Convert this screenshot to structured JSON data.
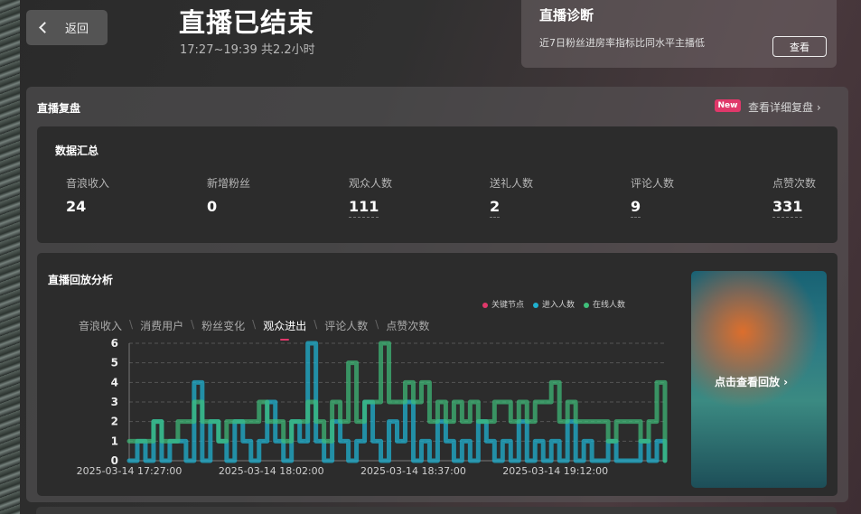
{
  "header": {
    "back_label": "返回",
    "title": "直播已结束",
    "subtitle": "17:27~19:39 共2.2小时"
  },
  "diagnosis": {
    "title": "直播诊断",
    "text": "近7日粉丝进房率指标比同水平主播低",
    "button": "查看"
  },
  "review": {
    "title": "直播复盘",
    "badge": "New",
    "detail_link": "查看详细复盘 ›"
  },
  "summary": {
    "title": "数据汇总",
    "metrics": [
      {
        "label": "音浪收入",
        "value": "24"
      },
      {
        "label": "新增粉丝",
        "value": "0"
      },
      {
        "label": "观众人数",
        "value": "111"
      },
      {
        "label": "送礼人数",
        "value": "2"
      },
      {
        "label": "评论人数",
        "value": "9"
      },
      {
        "label": "点赞次数",
        "value": "331"
      }
    ]
  },
  "analysis": {
    "title": "直播回放分析",
    "tabs": [
      "音浪收入",
      "消费用户",
      "粉丝变化",
      "观众进出",
      "评论人数",
      "点赞次数"
    ],
    "active_tab": 3,
    "replay_label": "点击查看回放 ›"
  },
  "colors": {
    "accent": "#e0386a",
    "enter": "#1fb0cf",
    "online": "#3fbf7a"
  },
  "chart_data": {
    "type": "line",
    "legend": [
      "关键节点",
      "进入人数",
      "在线人数"
    ],
    "legend_placement": "top-right",
    "x_tick_labels": [
      "2025-03-14 17:27:00",
      "2025-03-14 18:02:00",
      "2025-03-14 18:37:00",
      "2025-03-14 19:12:00"
    ],
    "x_range_minutes": [
      0,
      132
    ],
    "ylim": [
      0,
      6
    ],
    "y_ticks": [
      0,
      1,
      2,
      3,
      4,
      5,
      6
    ],
    "grid": true,
    "series": [
      {
        "name": "进入人数",
        "minutes": [
          0,
          2,
          4,
          6,
          8,
          10,
          12,
          14,
          16,
          18,
          20,
          22,
          24,
          26,
          28,
          30,
          32,
          34,
          36,
          38,
          40,
          42,
          44,
          46,
          48,
          50,
          52,
          54,
          56,
          58,
          60,
          62,
          64,
          66,
          68,
          70,
          72,
          74,
          76,
          78,
          80,
          82,
          84,
          86,
          88,
          90,
          92,
          94,
          96,
          98,
          100,
          102,
          104,
          106,
          108,
          110,
          112,
          114,
          116,
          118,
          120,
          122,
          124,
          126,
          128,
          130,
          132
        ],
        "values": [
          0,
          1,
          0,
          2,
          0,
          1,
          1,
          0,
          4,
          0,
          2,
          1,
          0,
          2,
          1,
          0,
          1,
          3,
          1,
          0,
          2,
          1,
          6,
          1,
          0,
          2,
          1,
          0,
          1,
          3,
          1,
          0,
          2,
          1,
          3,
          0,
          1,
          0,
          2,
          1,
          0,
          1,
          0,
          2,
          1,
          0,
          1,
          0,
          2,
          0,
          1,
          0,
          1,
          0,
          2,
          0,
          1,
          0,
          0,
          1,
          0,
          0,
          0,
          1,
          0,
          1,
          0
        ]
      },
      {
        "name": "在线人数",
        "minutes": [
          0,
          2,
          4,
          6,
          8,
          10,
          12,
          14,
          16,
          18,
          20,
          22,
          24,
          26,
          28,
          30,
          32,
          34,
          36,
          38,
          40,
          42,
          44,
          46,
          48,
          50,
          52,
          54,
          56,
          58,
          60,
          62,
          64,
          66,
          68,
          70,
          72,
          74,
          76,
          78,
          80,
          82,
          84,
          86,
          88,
          90,
          92,
          94,
          96,
          98,
          100,
          102,
          104,
          106,
          108,
          110,
          112,
          114,
          116,
          118,
          120,
          122,
          124,
          126,
          128,
          130,
          132
        ],
        "values": [
          1,
          1,
          1,
          2,
          1,
          1,
          2,
          2,
          3,
          2,
          2,
          1,
          2,
          2,
          2,
          2,
          3,
          2,
          2,
          1,
          2,
          2,
          3,
          2,
          1,
          3,
          2,
          5,
          2,
          3,
          3,
          6,
          3,
          3,
          4,
          3,
          4,
          2,
          3,
          2,
          3,
          2,
          3,
          2,
          2,
          3,
          3,
          2,
          3,
          2,
          3,
          3,
          4,
          2,
          3,
          2,
          2,
          2,
          2,
          1,
          2,
          2,
          2,
          1,
          2,
          4,
          0
        ]
      }
    ]
  }
}
